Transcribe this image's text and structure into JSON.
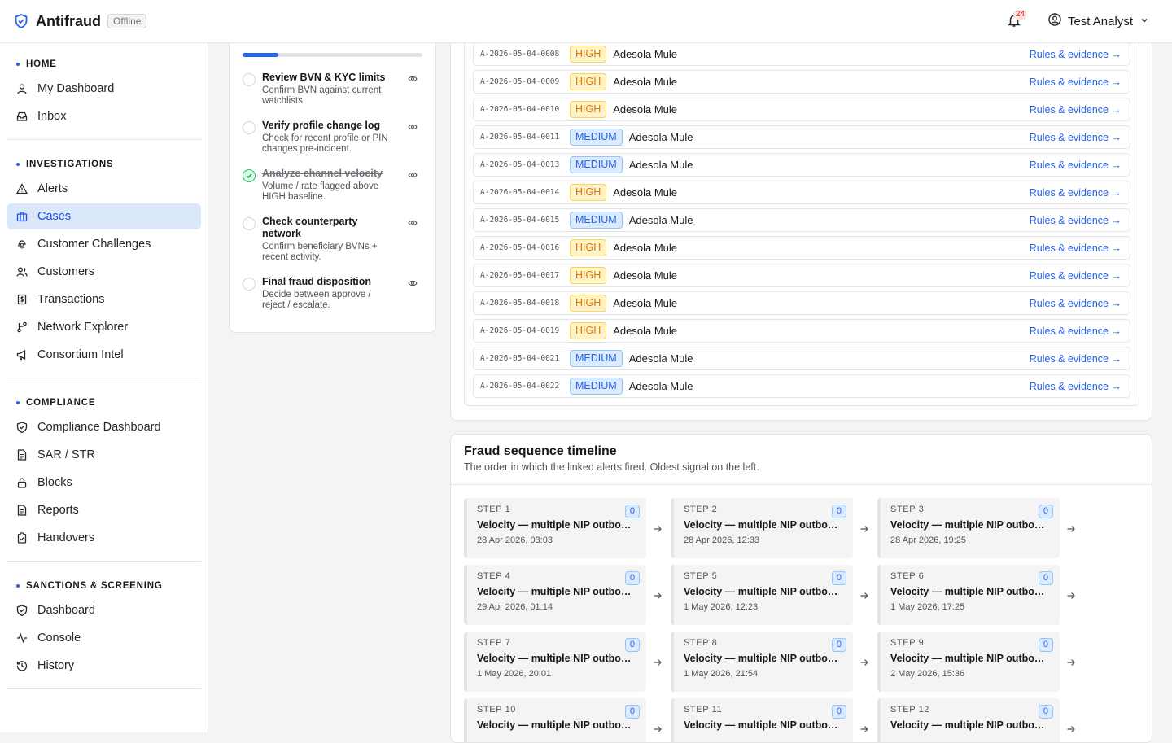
{
  "app": {
    "name": "Antifraud",
    "status_badge": "Offline",
    "notifications": "24",
    "user": "Test Analyst"
  },
  "sidebar": {
    "sections": [
      {
        "heading": "HOME",
        "items": [
          {
            "label": "My Dashboard",
            "icon": "dashboard-icon"
          },
          {
            "label": "Inbox",
            "icon": "inbox-icon"
          }
        ]
      },
      {
        "heading": "INVESTIGATIONS",
        "items": [
          {
            "label": "Alerts",
            "icon": "warning-icon"
          },
          {
            "label": "Cases",
            "icon": "briefcase-icon",
            "active": true
          },
          {
            "label": "Customer Challenges",
            "icon": "fingerprint-icon"
          },
          {
            "label": "Customers",
            "icon": "users-icon"
          },
          {
            "label": "Transactions",
            "icon": "receipt-icon"
          },
          {
            "label": "Network Explorer",
            "icon": "branch-icon"
          },
          {
            "label": "Consortium Intel",
            "icon": "megaphone-icon"
          }
        ]
      },
      {
        "heading": "COMPLIANCE",
        "items": [
          {
            "label": "Compliance Dashboard",
            "icon": "shield-check-icon"
          },
          {
            "label": "SAR / STR",
            "icon": "file-icon"
          },
          {
            "label": "Blocks",
            "icon": "lock-icon"
          },
          {
            "label": "Reports",
            "icon": "file-icon"
          },
          {
            "label": "Handovers",
            "icon": "clipboard-icon"
          }
        ]
      },
      {
        "heading": "SANCTIONS & SCREENING",
        "items": [
          {
            "label": "Dashboard",
            "icon": "shield-check-icon"
          },
          {
            "label": "Console",
            "icon": "activity-icon"
          },
          {
            "label": "History",
            "icon": "history-icon"
          }
        ]
      }
    ]
  },
  "checklist": {
    "progress": 0.2,
    "tasks": [
      {
        "title": "Review BVN & KYC limits",
        "desc": "Confirm BVN against current watchlists.",
        "done": false
      },
      {
        "title": "Verify profile change log",
        "desc": "Check for recent profile or PIN changes pre-incident.",
        "done": false
      },
      {
        "title": "Analyze channel velocity",
        "desc": "Volume / rate flagged above HIGH baseline.",
        "done": true
      },
      {
        "title": "Check counterparty network",
        "desc": "Confirm beneficiary BVNs + recent activity.",
        "done": false
      },
      {
        "title": "Final fraud disposition",
        "desc": "Decide between approve / reject / escalate.",
        "done": false
      }
    ]
  },
  "alerts": {
    "link_label": "Rules & evidence →",
    "rows": [
      {
        "id": "A-2026-05-04-0008",
        "severity": "HIGH",
        "name": "Adesola Mule"
      },
      {
        "id": "A-2026-05-04-0009",
        "severity": "HIGH",
        "name": "Adesola Mule"
      },
      {
        "id": "A-2026-05-04-0010",
        "severity": "HIGH",
        "name": "Adesola Mule"
      },
      {
        "id": "A-2026-05-04-0011",
        "severity": "MEDIUM",
        "name": "Adesola Mule"
      },
      {
        "id": "A-2026-05-04-0013",
        "severity": "MEDIUM",
        "name": "Adesola Mule"
      },
      {
        "id": "A-2026-05-04-0014",
        "severity": "HIGH",
        "name": "Adesola Mule"
      },
      {
        "id": "A-2026-05-04-0015",
        "severity": "MEDIUM",
        "name": "Adesola Mule"
      },
      {
        "id": "A-2026-05-04-0016",
        "severity": "HIGH",
        "name": "Adesola Mule"
      },
      {
        "id": "A-2026-05-04-0017",
        "severity": "HIGH",
        "name": "Adesola Mule"
      },
      {
        "id": "A-2026-05-04-0018",
        "severity": "HIGH",
        "name": "Adesola Mule"
      },
      {
        "id": "A-2026-05-04-0019",
        "severity": "HIGH",
        "name": "Adesola Mule"
      },
      {
        "id": "A-2026-05-04-0021",
        "severity": "MEDIUM",
        "name": "Adesola Mule"
      },
      {
        "id": "A-2026-05-04-0022",
        "severity": "MEDIUM",
        "name": "Adesola Mule"
      }
    ]
  },
  "timeline": {
    "title": "Fraud sequence timeline",
    "subtitle": "The order in which the linked alerts fired. Oldest signal on the left.",
    "steps": [
      {
        "label": "STEP 1",
        "count": "0",
        "title": "Velocity — multiple NIP outbound transfers",
        "time": "28 Apr 2026, 03:03"
      },
      {
        "label": "STEP 2",
        "count": "0",
        "title": "Velocity — multiple NIP outbound transfers",
        "time": "28 Apr 2026, 12:33"
      },
      {
        "label": "STEP 3",
        "count": "0",
        "title": "Velocity — multiple NIP outbound transfers",
        "time": "28 Apr 2026, 19:25"
      },
      {
        "label": "STEP 4",
        "count": "0",
        "title": "Velocity — multiple NIP outbound transfers",
        "time": "29 Apr 2026, 01:14"
      },
      {
        "label": "STEP 5",
        "count": "0",
        "title": "Velocity — multiple NIP outbound transfers",
        "time": "1 May 2026, 12:23"
      },
      {
        "label": "STEP 6",
        "count": "0",
        "title": "Velocity — multiple NIP outbound transfers",
        "time": "1 May 2026, 17:25"
      },
      {
        "label": "STEP 7",
        "count": "0",
        "title": "Velocity — multiple NIP outbound transfers",
        "time": "1 May 2026, 20:01"
      },
      {
        "label": "STEP 8",
        "count": "0",
        "title": "Velocity — multiple NIP outbound transfers",
        "time": "1 May 2026, 21:54"
      },
      {
        "label": "STEP 9",
        "count": "0",
        "title": "Velocity — multiple NIP outbound transfers",
        "time": "2 May 2026, 15:36"
      },
      {
        "label": "STEP 10",
        "count": "0",
        "title": "Velocity — multiple NIP outbound transfers",
        "time": ""
      },
      {
        "label": "STEP 11",
        "count": "0",
        "title": "Velocity — multiple NIP outbound transfers",
        "time": ""
      },
      {
        "label": "STEP 12",
        "count": "0",
        "title": "Velocity — multiple NIP outbound transfers",
        "time": ""
      }
    ]
  }
}
